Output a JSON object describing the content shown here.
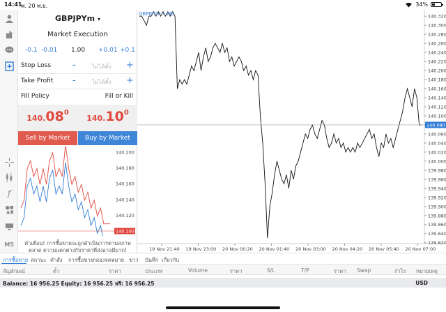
{
  "status_bar": {
    "time": "14:41",
    "date": "พ. 20 พ.ย.",
    "battery": "34%"
  },
  "toolbar": {
    "icons": [
      "user-icon",
      "accounts-icon",
      "chat-icon",
      "new-order-icon",
      "crosshair-icon",
      "indicators-icon",
      "function-icon",
      "objects-icon",
      "timeframe-icon"
    ],
    "timeframe_label": "M5"
  },
  "order_panel": {
    "symbol": "GBPJPYm",
    "symbol_caret": "▾",
    "execution": "Market Execution",
    "volume": {
      "minus_large": "-0.1",
      "minus_small": "-0.01",
      "value": "1.00",
      "plus_small": "+0.01",
      "plus_large": "+0.1"
    },
    "stop_loss": {
      "label": "Stop Loss",
      "minus": "-",
      "placeholder": "ไม่ได้ตั้ง",
      "plus": "+"
    },
    "take_profit": {
      "label": "Take Profit",
      "minus": "-",
      "placeholder": "ไม่ได้ตั้ง",
      "plus": "+"
    },
    "fill_policy": {
      "label": "Fill Policy",
      "value": "Fill or Kill"
    },
    "sell_price": {
      "prefix": "140.",
      "big": "08",
      "sup": "0"
    },
    "buy_price": {
      "prefix": "140.",
      "big": "10",
      "sup": "0"
    },
    "sell_button": "Sell by Market",
    "buy_button": "Buy by Market",
    "warning": "คำเตือน! การซื้อขายจะถูกดำเนินการตามสภาพตลาด ความแตกต่างกับราคาที่ส่งอาจมีมาก!"
  },
  "mini_chart": {
    "y_ticks": [
      "140.200",
      "140.180",
      "140.160",
      "140.140",
      "140.120"
    ],
    "ask_tag": "140.100",
    "bid_tag": "140.080",
    "colors": {
      "ask": "#e0473d",
      "bid": "#2f7bd6"
    }
  },
  "main_chart": {
    "label": "GBPJPYm • M5",
    "current_price_tag": "140.080",
    "colors": {
      "line": "#111111",
      "current": "#2f7bd6"
    }
  },
  "chart_data": {
    "type": "line",
    "title": "",
    "symbol": "GBPJPYm",
    "timeframe": "M5",
    "x_ticks": [
      "19 Nov 21:40",
      "19 Nov 23:00",
      "20 Nov 00:20",
      "20 Nov 01:40",
      "20 Nov 03:00",
      "20 Nov 04:20",
      "20 Nov 05:40",
      "20 Nov 07:00"
    ],
    "y_ticks": [
      140.32,
      140.3,
      140.28,
      140.26,
      140.24,
      140.22,
      140.2,
      140.18,
      140.16,
      140.14,
      140.12,
      140.1,
      140.08,
      140.06,
      140.04,
      140.02,
      140.0,
      139.98,
      139.96,
      139.94,
      139.92,
      139.9,
      139.88,
      139.86,
      139.84,
      139.82
    ],
    "ylim": [
      139.818,
      140.328
    ],
    "current_price": 140.08,
    "series": [
      {
        "values": [
          140.32,
          140.32,
          140.31,
          140.3,
          140.32,
          140.32,
          140.33,
          140.32,
          140.33,
          140.32,
          140.33,
          140.32,
          140.33,
          140.32,
          140.33,
          140.32,
          140.16,
          140.18,
          140.17,
          140.18,
          140.17,
          140.19,
          140.21,
          140.2,
          140.22,
          140.24,
          140.2,
          140.23,
          140.25,
          140.22,
          140.23,
          140.25,
          140.26,
          140.25,
          140.24,
          140.26,
          140.24,
          140.25,
          140.22,
          140.23,
          140.21,
          140.22,
          140.23,
          140.22,
          140.2,
          140.21,
          140.19,
          140.2,
          140.18,
          140.2,
          140.19,
          140.1,
          140.04,
          139.95,
          139.83,
          139.9,
          139.93,
          139.97,
          140.0,
          139.98,
          139.96,
          139.95,
          139.97,
          139.94,
          139.98,
          139.96,
          139.99,
          140.0,
          140.02,
          140.04,
          140.06,
          140.05,
          140.07,
          140.08,
          140.06,
          140.05,
          140.07,
          140.09,
          140.08,
          140.05,
          140.03,
          140.04,
          140.06,
          140.04,
          140.05,
          140.03,
          140.04,
          140.02,
          140.03,
          140.02,
          140.03,
          140.02,
          140.04,
          140.03,
          140.04,
          140.05,
          140.06,
          140.07,
          140.05,
          140.06,
          140.03,
          140.01,
          140.04,
          140.03,
          140.06,
          140.04,
          140.05,
          140.03,
          140.05,
          140.07,
          140.09,
          140.11,
          140.14,
          140.16,
          140.14,
          140.12,
          140.16,
          140.14,
          140.08,
          140.08
        ]
      }
    ]
  },
  "bottom_tabs": [
    "การซื้อขาย",
    "สถานะ",
    "คำสั่ง",
    "การซื้อขาย",
    "กล่องจดหมาย",
    "ข่าว",
    "บันทึก",
    "เกี่ยวกับ"
  ],
  "table_columns": [
    "สัญลักษณ์",
    "ตั๋ว",
    "ราคา",
    "ประเภท",
    "Volume",
    "ราคา",
    "S/L",
    "T/P",
    "ราคา",
    "Swap",
    "กำไร",
    "หมายเหตุ"
  ],
  "balance_bar": {
    "text": "Balance: 16 956.25 Equity: 16 956.25 ฟรี: 16 956.25",
    "currency": "USD"
  }
}
